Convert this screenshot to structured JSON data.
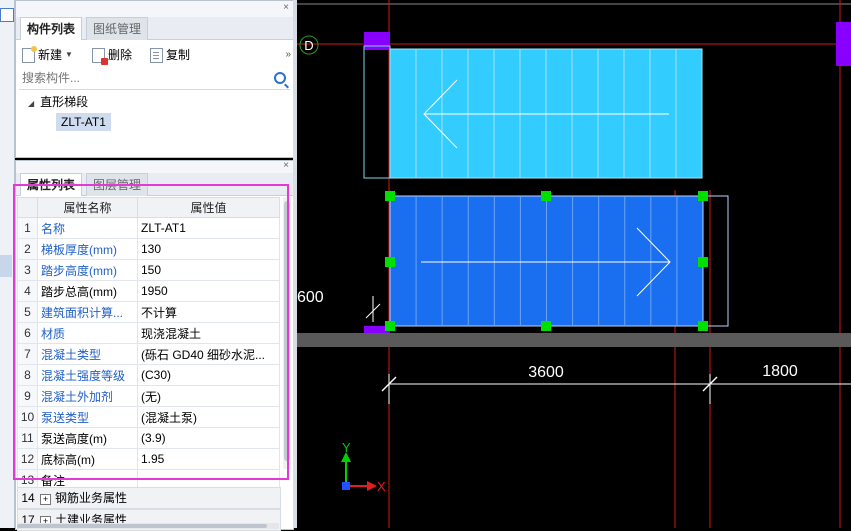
{
  "component_panel": {
    "tabs": [
      {
        "label": "构件列表",
        "active": true
      },
      {
        "label": "图纸管理",
        "active": false
      }
    ],
    "close": "×",
    "toolbar": {
      "new_label": "新建",
      "delete_label": "删除",
      "copy_label": "复制",
      "more": "»"
    },
    "search_placeholder": "搜索构件...",
    "tree": {
      "group": "直形梯段",
      "items": [
        "ZLT-AT1"
      ]
    }
  },
  "property_panel": {
    "tabs": [
      {
        "label": "属性列表",
        "active": true
      },
      {
        "label": "图层管理",
        "active": false
      }
    ],
    "close": "×",
    "columns": [
      "属性名称",
      "属性值"
    ],
    "rows": [
      {
        "num": "1",
        "name": "名称",
        "value": "ZLT-AT1",
        "blue": true
      },
      {
        "num": "2",
        "name": "梯板厚度(mm)",
        "value": "130",
        "blue": true
      },
      {
        "num": "3",
        "name": "踏步高度(mm)",
        "value": "150",
        "blue": true
      },
      {
        "num": "4",
        "name": "踏步总高(mm)",
        "value": "1950",
        "blue": false
      },
      {
        "num": "5",
        "name": "建筑面积计算...",
        "value": "不计算",
        "blue": true
      },
      {
        "num": "6",
        "name": "材质",
        "value": "现浇混凝土",
        "blue": true
      },
      {
        "num": "7",
        "name": "混凝土类型",
        "value": "(砾石 GD40 细砂水泥...",
        "blue": true
      },
      {
        "num": "8",
        "name": "混凝土强度等级",
        "value": "(C30)",
        "blue": true
      },
      {
        "num": "9",
        "name": "混凝土外加剂",
        "value": "(无)",
        "blue": true
      },
      {
        "num": "10",
        "name": "泵送类型",
        "value": "(混凝土泵)",
        "blue": true
      },
      {
        "num": "11",
        "name": "泵送高度(m)",
        "value": "(3.9)",
        "blue": false
      },
      {
        "num": "12",
        "name": "底标高(m)",
        "value": "1.95",
        "blue": false
      },
      {
        "num": "13",
        "name": "备注",
        "value": "",
        "blue": false
      }
    ],
    "extra_rows": [
      {
        "num": "14",
        "label": "钢筋业务属性"
      },
      {
        "num": "17",
        "label": "土建业务属性"
      }
    ]
  },
  "drawing": {
    "axis_label": "D",
    "dim_left": "600",
    "dim_1": "3600",
    "dim_2": "1800",
    "ucs_x": "X",
    "ucs_y": "Y",
    "colors": {
      "background": "#000000",
      "stair_upper": "#33ccff",
      "stair_lower": "#1a6ff0",
      "grip": "#00e000",
      "column": "#8800ff",
      "highlight": "#e23ad6"
    }
  }
}
